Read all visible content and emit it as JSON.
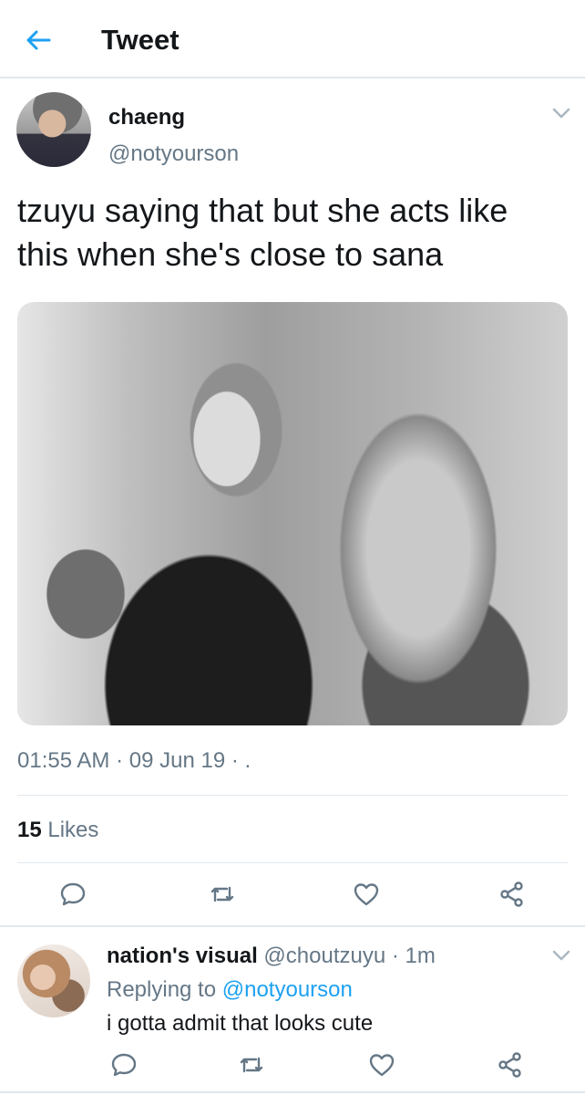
{
  "header": {
    "title": "Tweet",
    "back_icon": "arrow-left-icon"
  },
  "tweet": {
    "display_name": "chaeng",
    "handle": "@notyourson",
    "text": "tzuyu saying that but she acts like\nthis when she's close to sana",
    "photo_icon": "photo",
    "time": "01:55 AM",
    "separator": "·",
    "date": "09 Jun 19",
    "trailing": "· .",
    "likes_count": "15",
    "likes_label": "Likes",
    "actions": [
      "reply-icon",
      "retweet-icon",
      "like-icon",
      "share-icon"
    ]
  },
  "reply": {
    "display_name": "nation's visual",
    "handle": "@choutzuyu",
    "time": "· 1m",
    "replying_prefix": "Replying to",
    "replying_to": "@notyourson",
    "text": "i gotta admit that looks cute"
  },
  "colors": {
    "accent": "#1da1f2",
    "muted": "#657786",
    "text": "#14171a",
    "border": "#e1e8ed"
  }
}
